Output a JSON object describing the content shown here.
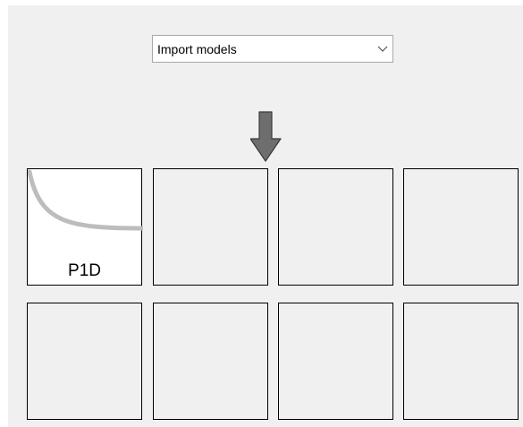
{
  "model_selector": {
    "selected": "Import models"
  },
  "slots": [
    {
      "label": "P1D",
      "loaded": true
    },
    {
      "label": "",
      "loaded": false
    },
    {
      "label": "",
      "loaded": false
    },
    {
      "label": "",
      "loaded": false
    },
    {
      "label": "",
      "loaded": false
    },
    {
      "label": "",
      "loaded": false
    },
    {
      "label": "",
      "loaded": false
    },
    {
      "label": "",
      "loaded": false
    }
  ],
  "icons": {
    "dropdown": "chevron-down-icon",
    "indicator": "arrow-down-icon",
    "model_thumbnail": "decay-curve-icon"
  },
  "colors": {
    "panel_bg": "#f0f0f0",
    "loaded_slot_bg": "#ffffff",
    "curve": "#bdbdbd",
    "indicator_arrow": "#6e6e6e"
  }
}
